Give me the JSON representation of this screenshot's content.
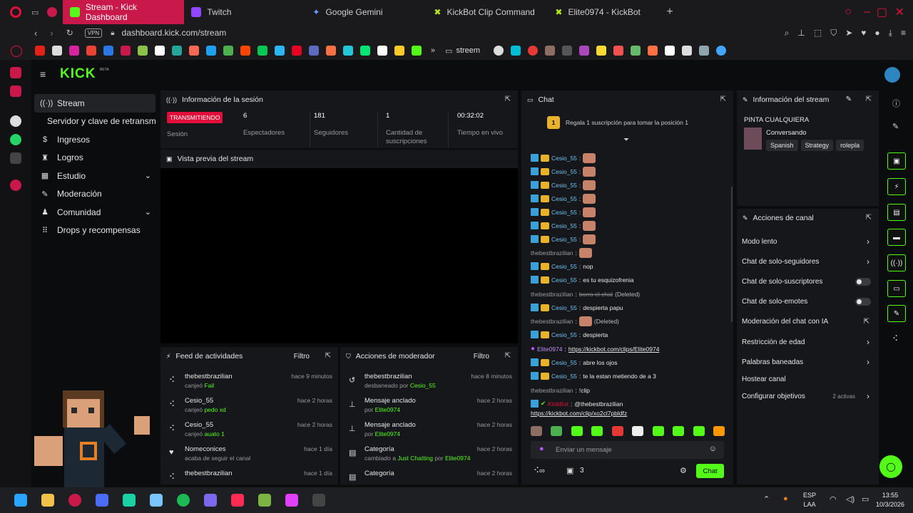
{
  "browser": {
    "tabs": [
      {
        "label": "Stream - Kick Dashboard",
        "active": true
      },
      {
        "label": "Twitch"
      },
      {
        "label": "Google Gemini"
      },
      {
        "label": "KickBot Clip Command"
      },
      {
        "label": "Elite0974 - KickBot"
      }
    ],
    "url": "dashboard.kick.com/stream",
    "vpn": "VPN",
    "bookmark_folder": "streem"
  },
  "kick": {
    "logo": "KICK",
    "beta": "BETA"
  },
  "sidebar": {
    "items": [
      {
        "label": "Stream"
      },
      {
        "label": "Servidor y clave de retransm"
      },
      {
        "label": "Ingresos"
      },
      {
        "label": "Logros"
      },
      {
        "label": "Estudio"
      },
      {
        "label": "Moderación"
      },
      {
        "label": "Comunidad"
      },
      {
        "label": "Drops y recompensas"
      }
    ]
  },
  "session": {
    "title": "Información de la sesión",
    "badge": "TRANSMITIENDO",
    "badge_label": "Sesión",
    "stats": [
      {
        "value": "6",
        "label": "Espectadores"
      },
      {
        "value": "181",
        "label": "Seguidores"
      },
      {
        "value": "1",
        "label": "Cantidad de suscripciones"
      },
      {
        "value": "00:32:02",
        "label": "Tiempo en vivo"
      }
    ]
  },
  "preview": {
    "title": "Vista previa del stream"
  },
  "feed": {
    "title": "Feed de actividades",
    "filter": "Filtro",
    "items": [
      {
        "user": "thebestbrazilian",
        "action": "canjeó",
        "reward": "Fail",
        "time": "hace 9 minutos"
      },
      {
        "user": "Cesio_55",
        "action": "canjeó",
        "reward": "pedo xd",
        "time": "hace 2 horas"
      },
      {
        "user": "Cesio_55",
        "action": "canjeó",
        "reward": "auato 1",
        "time": "hace 2 horas"
      },
      {
        "user": "Nomeconices",
        "action": "acaba de seguir el canal",
        "reward": "",
        "time": "hace 1 día"
      },
      {
        "user": "thebestbrazilian",
        "action": "",
        "reward": "",
        "time": "hace 1 día"
      }
    ]
  },
  "modactions": {
    "title": "Acciones de moderador",
    "filter": "Filtro",
    "items": [
      {
        "title": "thebestbrazilian",
        "sub": "desbaneado por",
        "who": "Cesio_55",
        "time": "hace 8 minutos"
      },
      {
        "title": "Mensaje anclado",
        "sub": "por",
        "who": "Elite0974",
        "time": "hace 2 horas"
      },
      {
        "title": "Mensaje anclado",
        "sub": "por",
        "who": "Elite0974",
        "time": "hace 2 horas"
      },
      {
        "title": "Categoría",
        "sub": "cambiado a",
        "extra": "Just Chatting",
        "sub2": "por",
        "who": "Elite0974",
        "time": "hace 2 horas"
      },
      {
        "title": "Categoría",
        "sub": "",
        "who": "",
        "time": "hace 2 horas"
      }
    ]
  },
  "chat": {
    "title": "Chat",
    "gift_rank": "1",
    "gift_text": "Regala 1 suscripción para tomar la posición 1",
    "messages": [
      {
        "user": "Cesio_55",
        "text": ""
      },
      {
        "user": "Cesio_55",
        "text": ""
      },
      {
        "user": "Cesio_55",
        "text": ""
      },
      {
        "user": "Cesio_55",
        "text": ""
      },
      {
        "user": "Cesio_55",
        "text": ""
      },
      {
        "user": "Cesio_55",
        "text": ""
      },
      {
        "user": "Cesio_55",
        "text": ""
      },
      {
        "user": "thebestbrazilian",
        "text": ""
      },
      {
        "user": "Cesio_55",
        "text": "nop"
      },
      {
        "user": "Cesio_55",
        "text": "es tu esquizofrenia"
      },
      {
        "user": "thebestbrazilian",
        "text": "borro el chat",
        "note": "(Deleted)"
      },
      {
        "user": "Cesio_55",
        "text": "despierta papu"
      },
      {
        "user": "thebestbrazilian",
        "text": "",
        "note": "(Deleted)"
      },
      {
        "user": "Cesio_55",
        "text": "despierta"
      },
      {
        "user": "Elite0974",
        "text": "https://kickbot.com/clips/Elite0974"
      },
      {
        "user": "Cesio_55",
        "text": "abre los ojos"
      },
      {
        "user": "Cesio_55",
        "text": "te la estan metiendo de a 3"
      },
      {
        "user": "thebestbrazilian",
        "text": "!clip"
      },
      {
        "user": "KickBot",
        "text": "@thebestbrazilian",
        "link": "https://kickbot.com/clip/xo2cl7pbldfz"
      }
    ],
    "input_placeholder": "Enviar un mensaje",
    "viewer_count": "3",
    "send_label": "Chat"
  },
  "streaminfo": {
    "title": "Información del stream",
    "stream_title": "PINTA CUALQUIERA",
    "category": "Conversando",
    "tags": [
      "Spanish",
      "Strategy",
      "rolepla"
    ]
  },
  "channel": {
    "title": "Acciones de canal",
    "items": [
      {
        "label": "Modo lento",
        "control": "chevron"
      },
      {
        "label": "Chat de solo-seguidores",
        "control": "chevron"
      },
      {
        "label": "Chat de solo-suscriptores",
        "control": "toggle"
      },
      {
        "label": "Chat de solo-emotes",
        "control": "toggle"
      },
      {
        "label": "Moderación del chat con IA",
        "control": "external"
      },
      {
        "label": "Restricción de edad",
        "control": "chevron"
      },
      {
        "label": "Palabras baneadas",
        "control": "chevron"
      },
      {
        "label": "Hostear canal",
        "control": "none"
      },
      {
        "label": "Configurar objetivos",
        "control": "chevron",
        "extra": "2 activas"
      }
    ]
  },
  "taskbar": {
    "lang": "ESP",
    "layout": "LAA",
    "time": "13:55",
    "date": "10/3/2026"
  },
  "colors": {
    "accent": "#53fc18",
    "tab_active": "#c9184a",
    "panel": "#16171a"
  }
}
